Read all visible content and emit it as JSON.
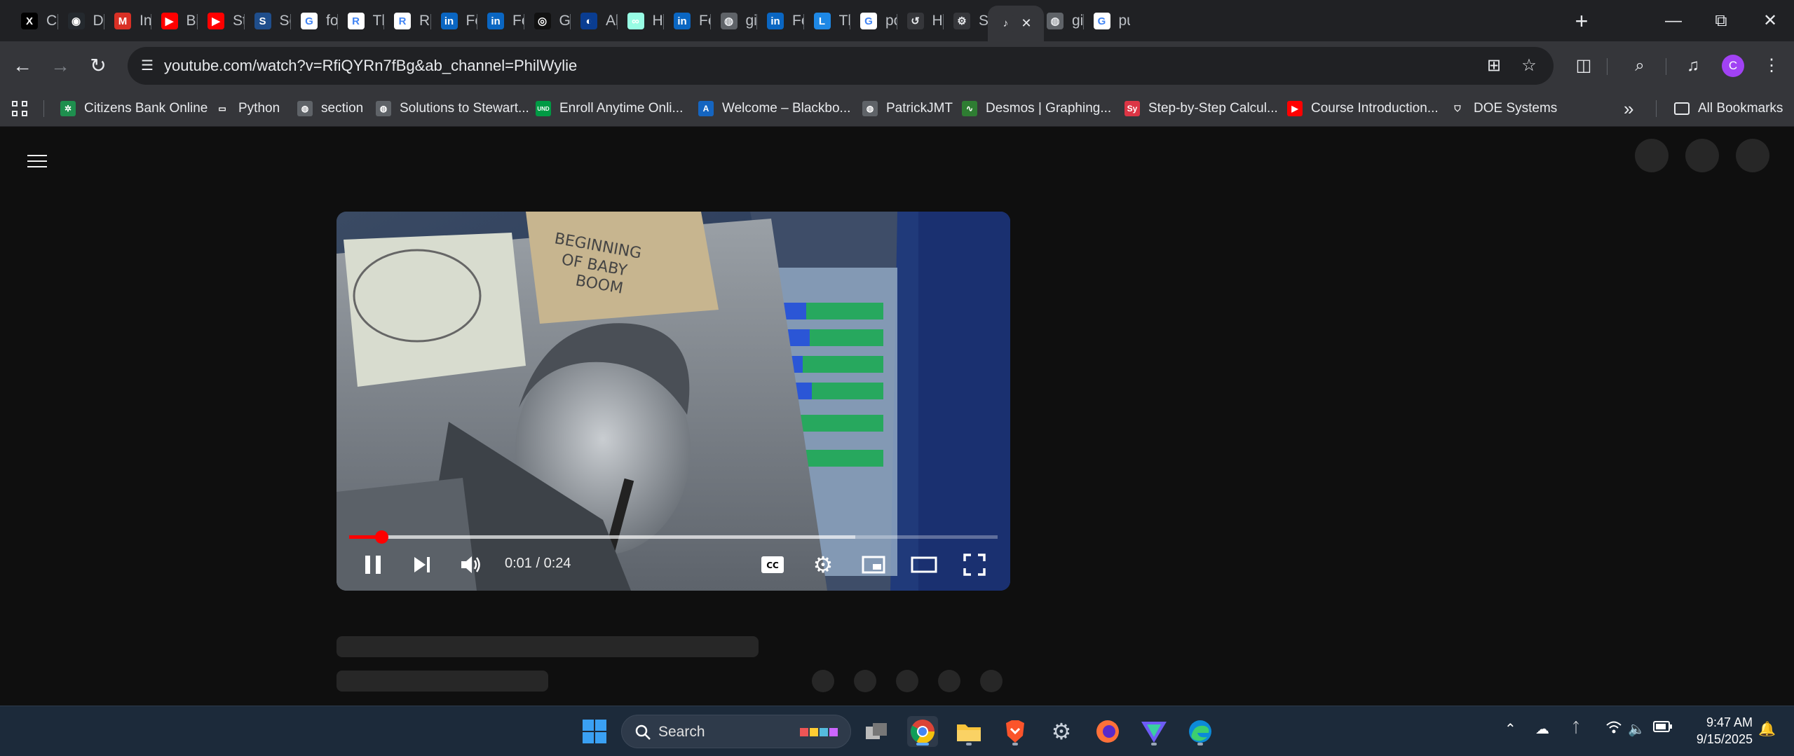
{
  "tabs": [
    {
      "title": "Cal",
      "icon": "x-icon",
      "color": "#000000",
      "glyph": "X"
    },
    {
      "title": "De",
      "icon": "github-icon",
      "color": "#24292e",
      "glyph": "◉"
    },
    {
      "title": "Inb",
      "icon": "gmail-icon",
      "color": "#d93025",
      "glyph": "M"
    },
    {
      "title": "Big",
      "icon": "youtube-icon",
      "color": "#ff0000",
      "glyph": "▶"
    },
    {
      "title": "Ste",
      "icon": "youtube-icon",
      "color": "#ff0000",
      "glyph": "▶"
    },
    {
      "title": "Sea",
      "icon": "ssrn-icon",
      "color": "#1f4e8c",
      "glyph": "S"
    },
    {
      "title": "for",
      "icon": "google-icon",
      "color": "#ffffff",
      "glyph": "G"
    },
    {
      "title": "Th",
      "icon": "researchgate-icon",
      "color": "#ffffff",
      "glyph": "R"
    },
    {
      "title": "Re",
      "icon": "researchgate-icon",
      "color": "#ffffff",
      "glyph": "R"
    },
    {
      "title": "Fee",
      "icon": "linkedin-icon",
      "color": "#0a66c2",
      "glyph": "in"
    },
    {
      "title": "Fee",
      "icon": "linkedin-icon",
      "color": "#0a66c2",
      "glyph": "in"
    },
    {
      "title": "Gra",
      "icon": "openai-icon",
      "color": "#111111",
      "glyph": "◎"
    },
    {
      "title": "Alt",
      "icon": "meta-icon",
      "color": "#0a3d91",
      "glyph": "◐"
    },
    {
      "title": "Hy",
      "icon": "hyperliquid-icon",
      "color": "#97fce4",
      "glyph": "∞"
    },
    {
      "title": "Fee",
      "icon": "linkedin-icon",
      "color": "#0a66c2",
      "glyph": "in"
    },
    {
      "title": "git",
      "icon": "globe-icon",
      "color": "#5f6368",
      "glyph": "◍"
    },
    {
      "title": "Fee",
      "icon": "linkedin-icon",
      "color": "#0a66c2",
      "glyph": "in"
    },
    {
      "title": "Th",
      "icon": "app-icon",
      "color": "#1e88e5",
      "glyph": "L"
    },
    {
      "title": "po",
      "icon": "google-icon",
      "color": "#ffffff",
      "glyph": "G"
    },
    {
      "title": "His",
      "icon": "history-icon",
      "color": "#35363a",
      "glyph": "↺"
    },
    {
      "title": "Set",
      "icon": "gear-icon",
      "color": "#35363a",
      "glyph": "⚙"
    },
    {
      "title": "",
      "icon": "audio-icon",
      "color": "#35363a",
      "glyph": "♪",
      "active": true
    },
    {
      "title": "git",
      "icon": "globe-icon",
      "color": "#5f6368",
      "glyph": "◍"
    },
    {
      "title": "pu",
      "icon": "google-icon",
      "color": "#ffffff",
      "glyph": "G"
    }
  ],
  "toolbar": {
    "url": "youtube.com/watch?v=RfiQYRn7fBg&ab_channel=PhilWylie",
    "profile_initial": "C"
  },
  "bookmarks": [
    {
      "label": "Citizens Bank Online",
      "icon": "citizens-icon",
      "color": "#1e8f4e",
      "glyph": "✲"
    },
    {
      "label": "Python",
      "icon": "folder-icon",
      "color": "#35363a",
      "glyph": "▭"
    },
    {
      "label": "section",
      "icon": "globe-icon",
      "color": "#5f6368",
      "glyph": "◍"
    },
    {
      "label": "Solutions to Stewart...",
      "icon": "globe-icon",
      "color": "#5f6368",
      "glyph": "◍"
    },
    {
      "label": "Enroll Anytime Onli...",
      "icon": "und-icon",
      "color": "#009a44",
      "glyph": "UND"
    },
    {
      "label": "Welcome – Blackbo...",
      "icon": "blackboard-icon",
      "color": "#1565c0",
      "glyph": "A"
    },
    {
      "label": "PatrickJMT",
      "icon": "globe-icon",
      "color": "#5f6368",
      "glyph": "◍"
    },
    {
      "label": "Desmos | Graphing...",
      "icon": "desmos-icon",
      "color": "#2e7d32",
      "glyph": "∿"
    },
    {
      "label": "Step-by-Step Calcul...",
      "icon": "symbolab-icon",
      "color": "#dc3545",
      "glyph": "Sy"
    },
    {
      "label": "Course Introduction...",
      "icon": "youtube-icon",
      "color": "#ff0000",
      "glyph": "▶"
    },
    {
      "label": "DOE Systems",
      "icon": "shield-icon",
      "color": "#35363a",
      "glyph": "⛉"
    }
  ],
  "bookmarks_more": "»",
  "all_bookmarks": "All Bookmarks",
  "player": {
    "time": "0:01 / 0:24",
    "played_fraction": 0.05,
    "buffered_fraction": 0.78,
    "note_text": "BEGINNING OF BABY BOOM"
  },
  "taskbar": {
    "search_label": "Search",
    "time": "9:47 AM",
    "date": "9/15/2025"
  }
}
